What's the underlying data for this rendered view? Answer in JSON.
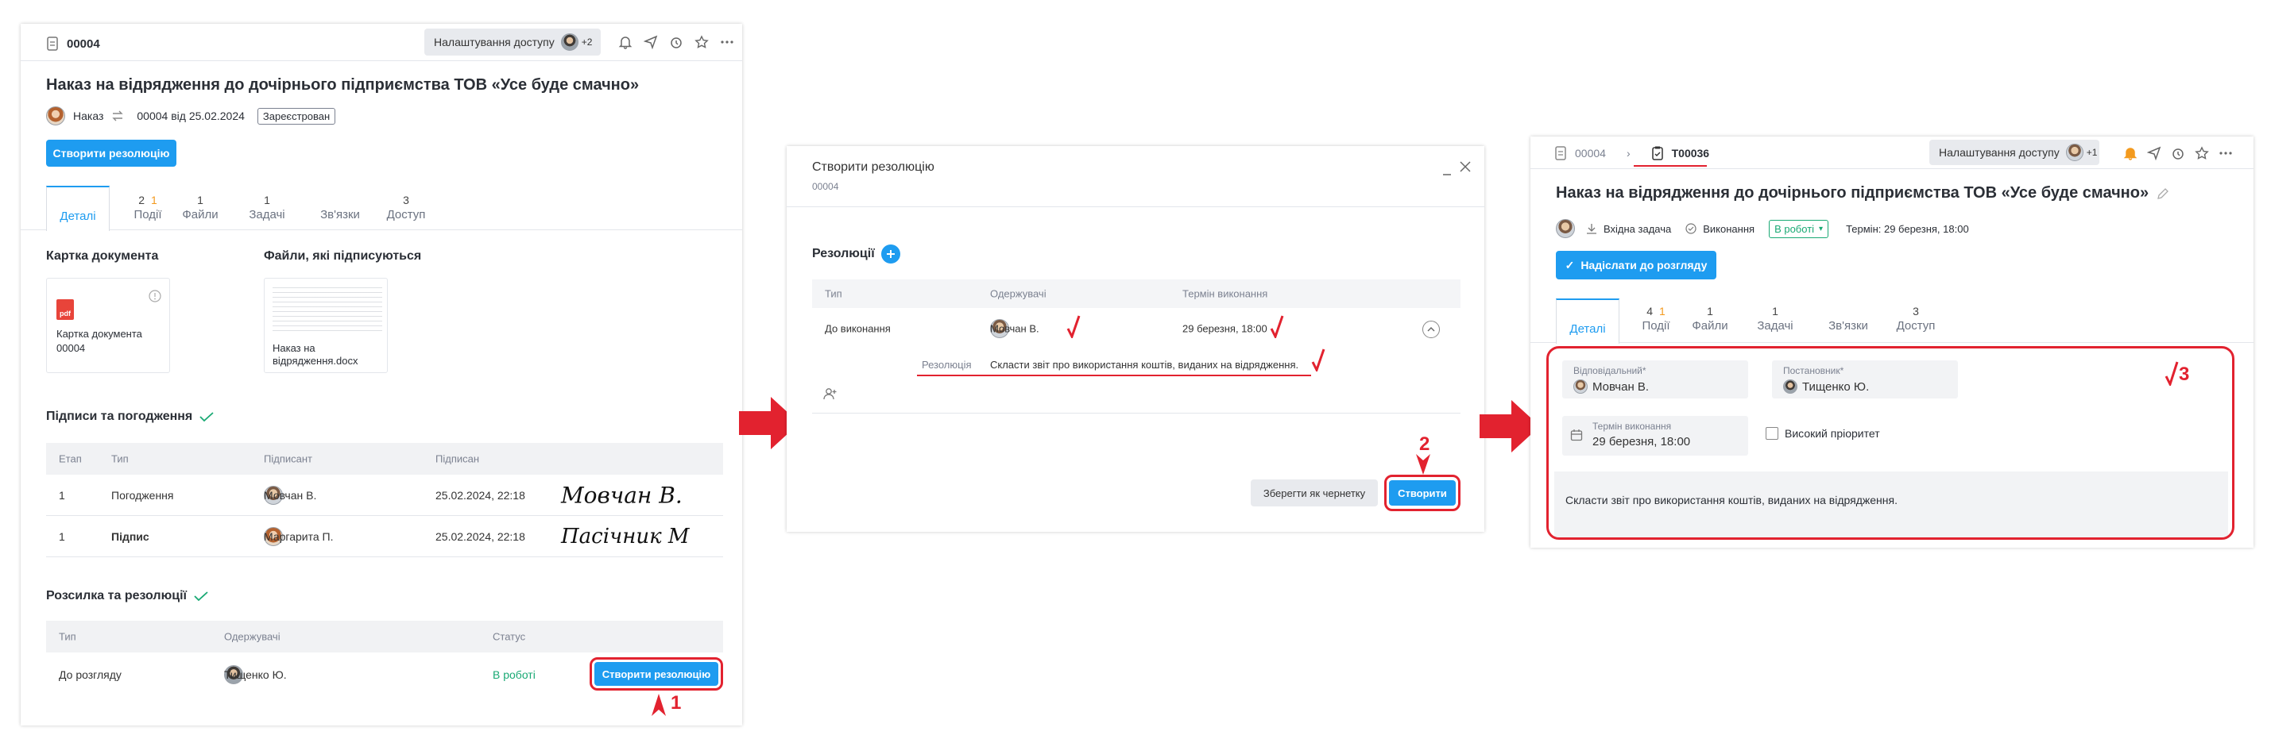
{
  "colors": {
    "accent": "#1e9cf0",
    "annotation": "#e2222f",
    "status_green": "#19a974",
    "counter_orange": "#f39a1e"
  },
  "left": {
    "doc_number": "00004",
    "access_button": "Налаштування доступу",
    "access_count": "+2",
    "title": "Наказ на відрядження до дочірнього підприємства ТОВ «Усе буде смачно»",
    "doc_type": "Наказ",
    "doc_ref": "00004 від 25.02.2024",
    "status": "Зареєстрован",
    "create_resolution": "Створити резолюцію",
    "tabs": [
      {
        "count": "",
        "label": "Деталі"
      },
      {
        "count": "2",
        "extra": "1",
        "label": "Події"
      },
      {
        "count": "1",
        "label": "Файли"
      },
      {
        "count": "1",
        "label": "Задачі"
      },
      {
        "count": "",
        "label": "Зв'язки"
      },
      {
        "count": "3",
        "label": "Доступ"
      }
    ],
    "card_section": "Картка документа",
    "files_section": "Файли, які підписуються",
    "card_name": "Картка документа",
    "card_number": "00004",
    "file_name": "Наказ на відрядження.docx",
    "pdf_badge": "pdf",
    "signatures_section": "Підписи та погодження",
    "sig_headers": [
      "Етап",
      "Тип",
      "Підписант",
      "Підписан"
    ],
    "sig_rows": [
      {
        "stage": "1",
        "type": "Погодження",
        "signer": "Мовчан В.",
        "date": "25.02.2024, 22:18",
        "signature": "Mовчан В."
      },
      {
        "stage": "1",
        "type": "Підпис",
        "signer": "Маргарита П.",
        "date": "25.02.2024, 22:18",
        "signature": "Пасічник М"
      }
    ],
    "dist_section": "Розсилка та резолюції",
    "dist_headers": [
      "Тип",
      "Одержувачі",
      "Статус"
    ],
    "dist_row": {
      "type": "До розгляду",
      "recipient": "Тищенко Ю.",
      "status": "В роботі",
      "button": "Створити резолюцію"
    },
    "marker": "1"
  },
  "modal": {
    "title": "Створити резолюцію",
    "subtitle": "00004",
    "section": "Резолюції",
    "headers": [
      "Тип",
      "Одержувачі",
      "Термін виконання"
    ],
    "row": {
      "type": "До виконання",
      "recipient": "Мовчан В.",
      "deadline": "29 березня, 18:00"
    },
    "resolution_label": "Резолюція",
    "resolution_text": "Скласти звіт про використання коштів, виданих на відрядження.",
    "save_draft": "Зберегти як чернетку",
    "create": "Створити",
    "marker": "2"
  },
  "right": {
    "breadcrumb_parent": "00004",
    "breadcrumb_current": "T00036",
    "access_button": "Налаштування доступу",
    "access_count": "+1",
    "title": "Наказ на відрядження до дочірнього підприємства ТОВ «Усе буде смачно»",
    "task_type": "Вхідна задача",
    "execution": "Виконання",
    "status": "В роботі",
    "deadline": "Термін: 29 березня, 18:00",
    "send_button": "Надіслати до розгляду",
    "tabs": [
      {
        "count": "",
        "label": "Деталі"
      },
      {
        "count": "4",
        "extra": "1",
        "label": "Події"
      },
      {
        "count": "1",
        "label": "Файли"
      },
      {
        "count": "1",
        "label": "Задачі"
      },
      {
        "count": "",
        "label": "Зв'язки"
      },
      {
        "count": "3",
        "label": "Доступ"
      }
    ],
    "responsible_label": "Відповідальний*",
    "responsible": "Мовчан В.",
    "author_label": "Постановник*",
    "author": "Тищенко Ю.",
    "deadline_label": "Термін виконання",
    "deadline_value": "29 березня, 18:00",
    "priority": "Високий пріоритет",
    "description": "Скласти звіт про використання коштів, виданих на відрядження.",
    "marker": "3"
  }
}
